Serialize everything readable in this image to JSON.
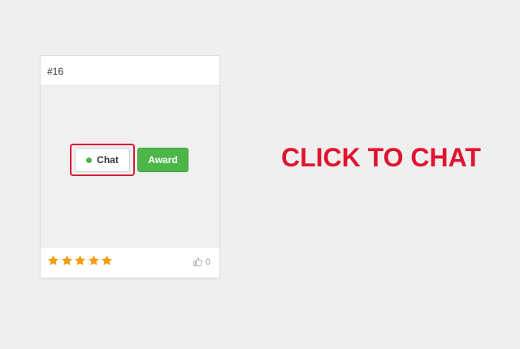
{
  "card": {
    "id_label": "#16",
    "chat_button": {
      "label": "Chat",
      "status": "online",
      "status_color": "#4cb648"
    },
    "award_button": {
      "label": "Award",
      "color": "#4cb648"
    },
    "rating": {
      "stars_filled": 5,
      "stars_total": 5,
      "star_color": "#f39c12"
    },
    "likes": {
      "icon": "thumbs-up-icon",
      "count": "0"
    }
  },
  "highlight_color": "#d8193a",
  "cta": {
    "text": "CLICK TO CHAT",
    "color": "#e0142f"
  }
}
